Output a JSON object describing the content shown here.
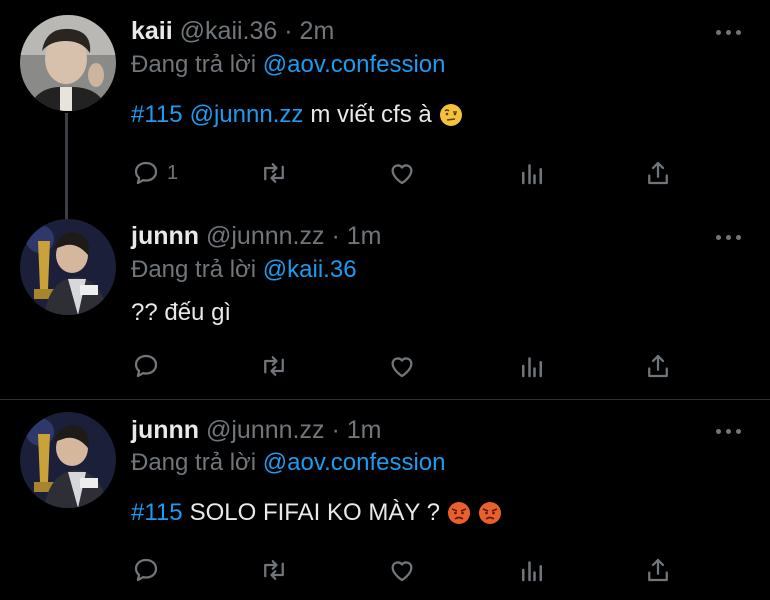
{
  "tweets": [
    {
      "name": "kaii",
      "handle": "@kaii.36",
      "time": "· 2m",
      "reply_prefix": "Đang trả lời",
      "reply_to": "@aov.confession",
      "hashtag": "#115",
      "mention": "@junnn.zz",
      "text": "m viết cfs à",
      "emoji": [
        "raised-eyebrow-emoji"
      ],
      "reply_count": "1"
    },
    {
      "name": "junnn",
      "handle": "@junnn.zz",
      "time": "· 1m",
      "reply_prefix": "Đang trả lời",
      "reply_to": "@kaii.36",
      "text": "?? đếu gì",
      "reply_count": ""
    },
    {
      "name": "junnn",
      "handle": "@junnn.zz",
      "time": "· 1m",
      "reply_prefix": "Đang trả lời",
      "reply_to": "@aov.confession",
      "hashtag": "#115",
      "text": "SOLO FIFAI KO MÀY ?",
      "emoji": [
        "angry-face-emoji",
        "angry-face-emoji"
      ],
      "reply_count": ""
    }
  ],
  "icons": [
    "reply-icon",
    "retweet-icon",
    "like-icon",
    "analytics-icon",
    "share-icon",
    "more-icon"
  ],
  "colors": {
    "background": "#000000",
    "text": "#e7e9ea",
    "muted": "#71767b",
    "link": "#1d9bf0",
    "divider": "#2f3336"
  }
}
